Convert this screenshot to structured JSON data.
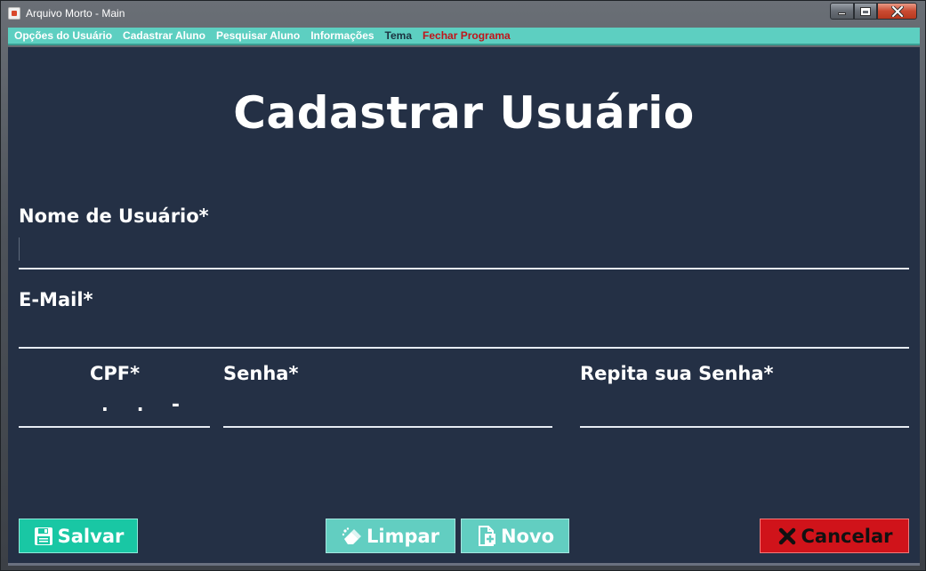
{
  "window": {
    "title": "Arquivo Morto - Main"
  },
  "menu": {
    "items": [
      {
        "label": "Opções do Usuário"
      },
      {
        "label": "Cadastrar Aluno"
      },
      {
        "label": "Pesquisar Aluno"
      },
      {
        "label": "Informações"
      },
      {
        "label": "Tema"
      },
      {
        "label": "Fechar Programa"
      }
    ]
  },
  "form": {
    "heading": "Cadastrar Usuário",
    "username": {
      "label": "Nome de Usuário*",
      "value": ""
    },
    "email": {
      "label": "E-Mail*",
      "value": ""
    },
    "cpf": {
      "label": "CPF*",
      "mask": " .  .  -"
    },
    "password": {
      "label": "Senha*",
      "value": ""
    },
    "password_repeat": {
      "label": "Repita sua Senha*",
      "value": ""
    }
  },
  "buttons": {
    "save": "Salvar",
    "clear": "Limpar",
    "new": "Novo",
    "cancel": "Cancelar"
  },
  "colors": {
    "panel": "#243045",
    "menubar": "#5dcfc1",
    "save": "#19c7a4",
    "secondary": "#62cec1",
    "cancel": "#d0131a",
    "danger_text": "#c0141a"
  },
  "icons": {
    "app": "java-cup-icon",
    "save": "floppy-disk-icon",
    "clear": "eraser-icon",
    "new": "new-file-icon",
    "cancel": "x-mark-icon"
  }
}
